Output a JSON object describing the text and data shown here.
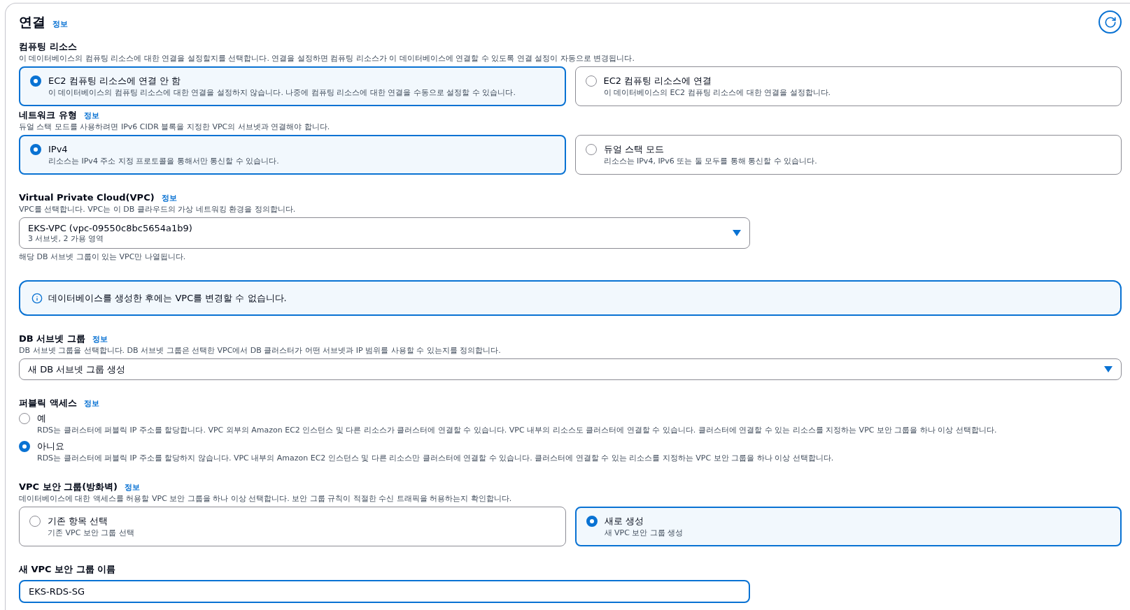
{
  "section": {
    "title": "연결",
    "info": "정보"
  },
  "fields": [
    {
      "kind": "tiles",
      "label": "컴퓨팅 리소스",
      "description": "이 데이터베이스의 컴퓨팅 리소스에 대한 연결을 설정할지를 선택합니다. 연결을 설정하면 컴퓨팅 리소스가 이 데이터베이스에 연결할 수 있도록 연결 설정이 자동으로 변경됩니다.",
      "options": [
        {
          "title": "EC2 컴퓨팅 리소스에 연결 안 함",
          "description": "이 데이터베이스의 컴퓨팅 리소스에 대한 연결을 설정하지 않습니다. 나중에 컴퓨팅 리소스에 대한 연결을 수동으로 설정할 수 있습니다.",
          "selected": true
        },
        {
          "title": "EC2 컴퓨팅 리소스에 연결",
          "description": "이 데이터베이스의 EC2 컴퓨팅 리소스에 대한 연결을 설정합니다.",
          "selected": false
        }
      ]
    },
    {
      "kind": "tiles",
      "label": "네트워크 유형",
      "info": "정보",
      "description": "듀얼 스택 모드를 사용하려면 IPv6 CIDR 블록을 지정한 VPC의 서브넷과 연결해야 합니다.",
      "options": [
        {
          "title": "IPv4",
          "description": "리소스는 IPv4 주소 지정 프로토콜을 통해서만 통신할 수 있습니다.",
          "selected": true
        },
        {
          "title": "듀얼 스택 모드",
          "description": "리소스는 IPv4, IPv6 또는 둘 모두를 통해 통신할 수 있습니다.",
          "selected": false
        }
      ]
    },
    {
      "kind": "select",
      "label": "Virtual Private Cloud(VPC)",
      "info": "정보",
      "description": "VPC를 선택합니다. VPC는 이 DB 클라우드의 가상 네트워킹 환경을 정의합니다.",
      "value": "EKS-VPC (vpc-09550c8bc5654a1b9)",
      "secondary": "3 서브넷, 2 가용 영역",
      "hint": "해당 DB 서브넷 그룹이 있는 VPC만 나열됩니다.",
      "full_width": false
    },
    {
      "kind": "alert",
      "text": "데이터베이스를 생성한 후에는 VPC를 변경할 수 없습니다."
    },
    {
      "kind": "select",
      "label": "DB 서브넷 그룹",
      "info": "정보",
      "description": "DB 서브넷 그룹을 선택합니다. DB 서브넷 그룹은 선택한 VPC에서 DB 클러스터가 어떤 서브넷과 IP 범위를 사용할 수 있는지를 정의합니다.",
      "value": "새 DB 서브넷 그룹 생성",
      "full_width": true
    },
    {
      "kind": "radios",
      "label": "퍼블릭 액세스",
      "info": "정보",
      "options": [
        {
          "title": "예",
          "description": "RDS는 클러스터에 퍼블릭 IP 주소를 할당합니다. VPC 외부의 Amazon EC2 인스턴스 및 다른 리소스가 클러스터에 연결할 수 있습니다. VPC 내부의 리소스도 클러스터에 연결할 수 있습니다. 클러스터에 연결할 수 있는 리소스를 지정하는 VPC 보안 그룹을 하나 이상 선택합니다.",
          "selected": false
        },
        {
          "title": "아니요",
          "description": "RDS는 클러스터에 퍼블릭 IP 주소를 할당하지 않습니다. VPC 내부의 Amazon EC2 인스턴스 및 다른 리소스만 클러스터에 연결할 수 있습니다. 클러스터에 연결할 수 있는 리소스를 지정하는 VPC 보안 그룹을 하나 이상 선택합니다.",
          "selected": true
        }
      ]
    },
    {
      "kind": "tiles",
      "label": "VPC 보안 그룹(방화벽)",
      "info": "정보",
      "description": "데이터베이스에 대한 액세스를 허용할 VPC 보안 그룹을 하나 이상 선택합니다. 보안 그룹 규칙이 적절한 수신 트래픽을 허용하는지 확인합니다.",
      "options": [
        {
          "title": "기존 항목 선택",
          "description": "기존 VPC 보안 그룹 선택",
          "selected": false
        },
        {
          "title": "새로 생성",
          "description": "새 VPC 보안 그룹 생성",
          "selected": true
        }
      ]
    },
    {
      "kind": "input",
      "label": "새 VPC 보안 그룹 이름",
      "value": "EKS-RDS-SG",
      "focused": true
    }
  ]
}
